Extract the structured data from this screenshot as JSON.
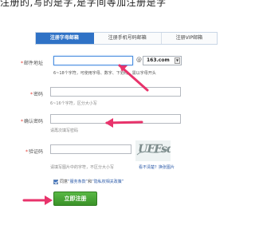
{
  "top_text": "注册的,写的是字,是字间等加注册是字",
  "tabs": [
    {
      "label": "注册字母邮箱",
      "active": true
    },
    {
      "label": "注册手机号码邮箱",
      "active": false
    },
    {
      "label": "注册VIP邮箱",
      "active": false
    }
  ],
  "form": {
    "email": {
      "required_mark": "*",
      "label": "邮件地址",
      "value": "",
      "at": "@",
      "domain": "163.com",
      "hint": "6~18个字符，可使用字母、数字、下划线，需以字母开头"
    },
    "password": {
      "required_mark": "*",
      "label": "密码",
      "value": "",
      "hint": "6~16个字符，区分大小写"
    },
    "confirm": {
      "required_mark": "*",
      "label": "确认密码",
      "value": "",
      "hint": "请再次填写密码"
    },
    "captcha": {
      "required_mark": "*",
      "label": "验证码",
      "value": "",
      "hint": "请填写图片中的字符，不区分大小写",
      "image_text": "UFFsde",
      "refresh_prefix": "看不清楚？",
      "refresh_link": "换张图片"
    }
  },
  "agreement": {
    "checked": true,
    "prefix": "同意",
    "terms": "“服务条款”",
    "and": "和",
    "privacy": "“隐私权相关政策”"
  },
  "submit_label": "立即注册",
  "colors": {
    "tab_active": "#2f72c6",
    "submit": "#4aa637",
    "arrow": "#e8336b",
    "required": "#e0392f"
  }
}
